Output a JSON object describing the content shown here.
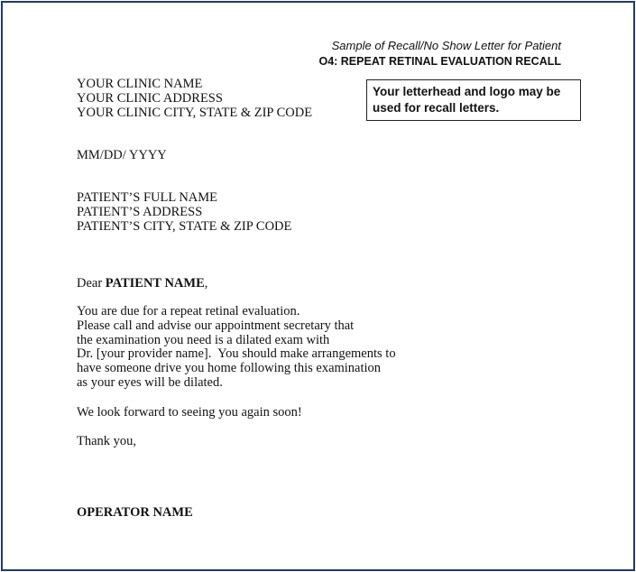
{
  "header": {
    "sample_caption": "Sample of Recall/No Show Letter for Patient",
    "letter_title": "O4: REPEAT RETINAL EVALUATION RECALL"
  },
  "note_box": {
    "text": "Your letterhead and logo may be used for recall letters."
  },
  "clinic": {
    "name": "YOUR CLINIC NAME",
    "address": "YOUR CLINIC ADDRESS",
    "city_state_zip": "YOUR CLINIC CITY, STATE & ZIP CODE"
  },
  "date": "MM/DD/ YYYY",
  "patient": {
    "full_name": "PATIENT’S FULL NAME",
    "address": "PATIENT’S ADDRESS",
    "city_state_zip": "PATIENT’S CITY, STATE & ZIP CODE"
  },
  "greeting": {
    "salutation": "Dear ",
    "name": "PATIENT NAME",
    "punct": ","
  },
  "body_lines": [
    "You are due for a repeat retinal evaluation.",
    "Please call and advise our appointment secretary that",
    "the examination you need is a dilated exam with",
    "Dr. [your provider name].  You should make arrangements to",
    "have someone drive you home following this examination",
    "as your eyes will be dilated."
  ],
  "closing": {
    "line1": "We look forward to seeing you again soon!",
    "line2": "Thank you,"
  },
  "signature": "OPERATOR NAME"
}
